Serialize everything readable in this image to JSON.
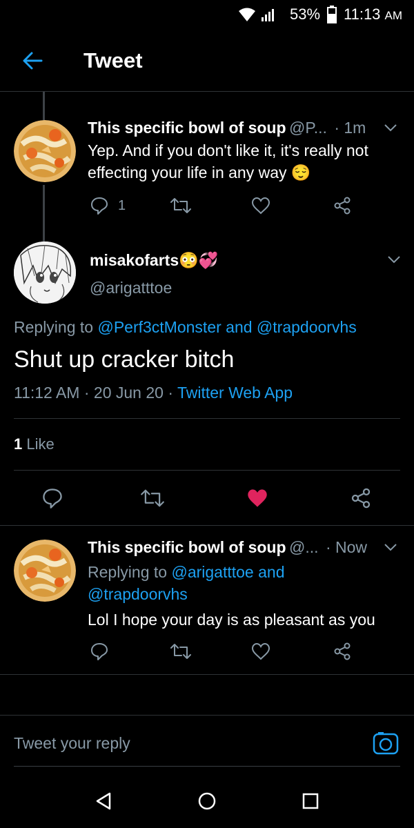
{
  "status_bar": {
    "battery": "53%",
    "time": "11:13",
    "ampm": "AM"
  },
  "header": {
    "title": "Tweet"
  },
  "parent_tweet": {
    "name": "This specific bowl of soup",
    "handle": "@P...",
    "time": "· 1m",
    "text": "Yep. And if you don't like it, it's really not effecting your life in any way 😌",
    "reply_count": "1"
  },
  "main_tweet": {
    "name": "misakofarts😳💞",
    "handle": "@arigatttoe",
    "replying_prefix": "Replying to ",
    "replying_user1": "@Perf3ctMonster",
    "replying_and": " and ",
    "replying_user2": "@trapdoorvhs",
    "text": "Shut up cracker bitch",
    "timestamp": "11:12 AM · 20 Jun 20 · ",
    "source": "Twitter Web App",
    "like_count": "1",
    "like_label": " Like"
  },
  "reply_tweet": {
    "name": "This specific bowl of soup",
    "handle": "@...",
    "time": "· Now",
    "replying_prefix": "Replying to ",
    "replying_user1": "@arigatttoe",
    "replying_and": " and",
    "replying_user2": "@trapdoorvhs",
    "text": "Lol I hope your day is as pleasant as you"
  },
  "composer": {
    "placeholder": "Tweet your reply"
  },
  "colors": {
    "accent": "#1da1f2",
    "like": "#e0245e",
    "muted": "#8899a6",
    "divider": "#2f3336"
  }
}
